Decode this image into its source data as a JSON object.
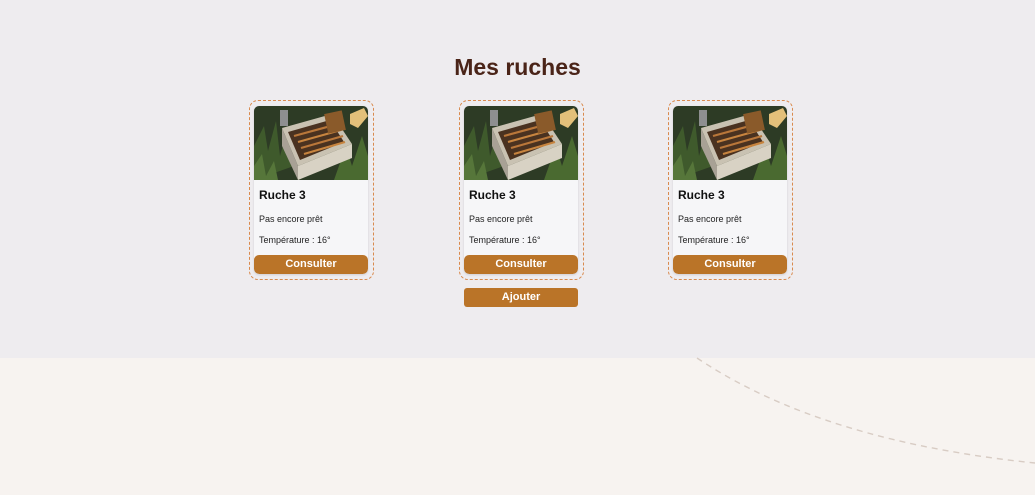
{
  "section": {
    "title": "Mes ruches",
    "add_label": "Ajouter"
  },
  "hives": [
    {
      "name": "Ruche 3",
      "status": "Pas encore prêt",
      "temperature": "Température : 16°",
      "action_label": "Consulter"
    },
    {
      "name": "Ruche 3",
      "status": "Pas encore prêt",
      "temperature": "Température : 16°",
      "action_label": "Consulter"
    },
    {
      "name": "Ruche 3",
      "status": "Pas encore prêt",
      "temperature": "Température : 16°",
      "action_label": "Consulter"
    }
  ],
  "colors": {
    "accent": "#ba7428",
    "title": "#4a2418",
    "card_border": "#d98a4e",
    "top_background": "#eeecef",
    "bottom_background": "#f7f3f0"
  },
  "icons": {
    "hive_photo": "beehive-frames-photo"
  }
}
